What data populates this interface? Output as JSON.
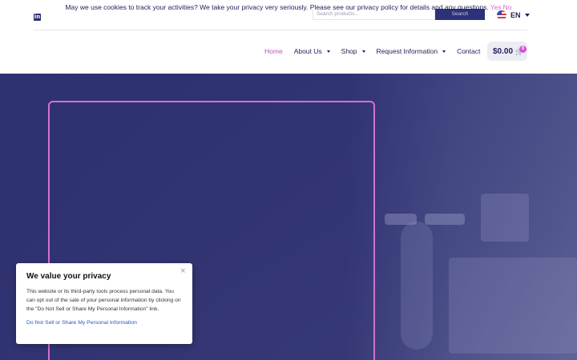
{
  "cookie_banner": {
    "message": "May we use cookies to track your activities? We take your privacy very seriously. Please see our privacy policy for details and any questions.",
    "yes_label": "Yes",
    "no_label": "No"
  },
  "header": {
    "social_icon": "linkedin-icon",
    "search": {
      "placeholder": "Search products...",
      "button_label": "Search"
    },
    "language": {
      "label": "EN",
      "icon": "us-flag-icon"
    },
    "nav": {
      "items": [
        {
          "label": "Home",
          "active": true
        },
        {
          "label": "About Us",
          "has_dropdown": true
        },
        {
          "label": "Shop",
          "has_dropdown": true
        },
        {
          "label": "Request Information",
          "has_dropdown": true
        },
        {
          "label": "Contact"
        }
      ]
    },
    "cart": {
      "total": "$0.00",
      "count": "0",
      "icon": "cart-icon"
    }
  },
  "privacy_card": {
    "title": "We value your privacy",
    "body": "This website or its third-party tools process personal data. You can opt out of the sale of your personal information by clicking on the \"Do Not Sell or Share My Personal Information\" link.",
    "link_label": "Do Not Sell or Share My Personal Information",
    "close_icon": "close-icon"
  },
  "colors": {
    "brand_navy": "#2c2f6e",
    "accent_pink": "#d66fd2",
    "link_blue": "#2b55c2"
  }
}
